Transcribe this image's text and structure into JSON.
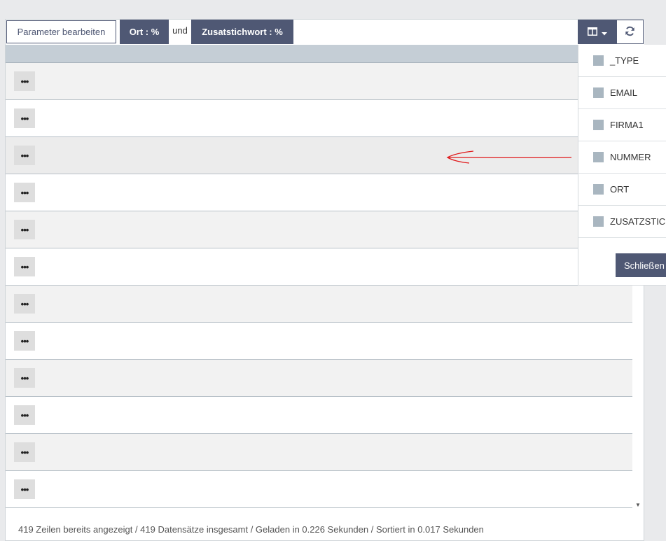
{
  "toolbar": {
    "params_button": "Parameter bearbeiten",
    "filters": [
      {
        "label": "Ort : %"
      },
      {
        "label": "Zusatstichwort : %"
      }
    ],
    "connector": "und",
    "columns_button_icon": "table-columns-icon",
    "refresh_button_icon": "refresh-icon"
  },
  "grid": {
    "row_action_label": "•••",
    "row_count_visible": 12,
    "highlighted_row_index": 2
  },
  "column_menu": {
    "items": [
      {
        "label": "_TYPE"
      },
      {
        "label": "EMAIL"
      },
      {
        "label": "FIRMA1"
      },
      {
        "label": "NUMMER"
      },
      {
        "label": "ORT"
      },
      {
        "label": "ZUSATZSTICH"
      }
    ],
    "close_label": "Schließen"
  },
  "footer": {
    "status": "419 Zeilen bereits angezeigt / 419 Datensätze insgesamt / Geladen in 0.226 Sekunden / Sortiert in 0.017 Sekunden"
  },
  "colors": {
    "accent": "#4f5874",
    "header": "#c5ced6",
    "annotation": "#e0191b"
  }
}
